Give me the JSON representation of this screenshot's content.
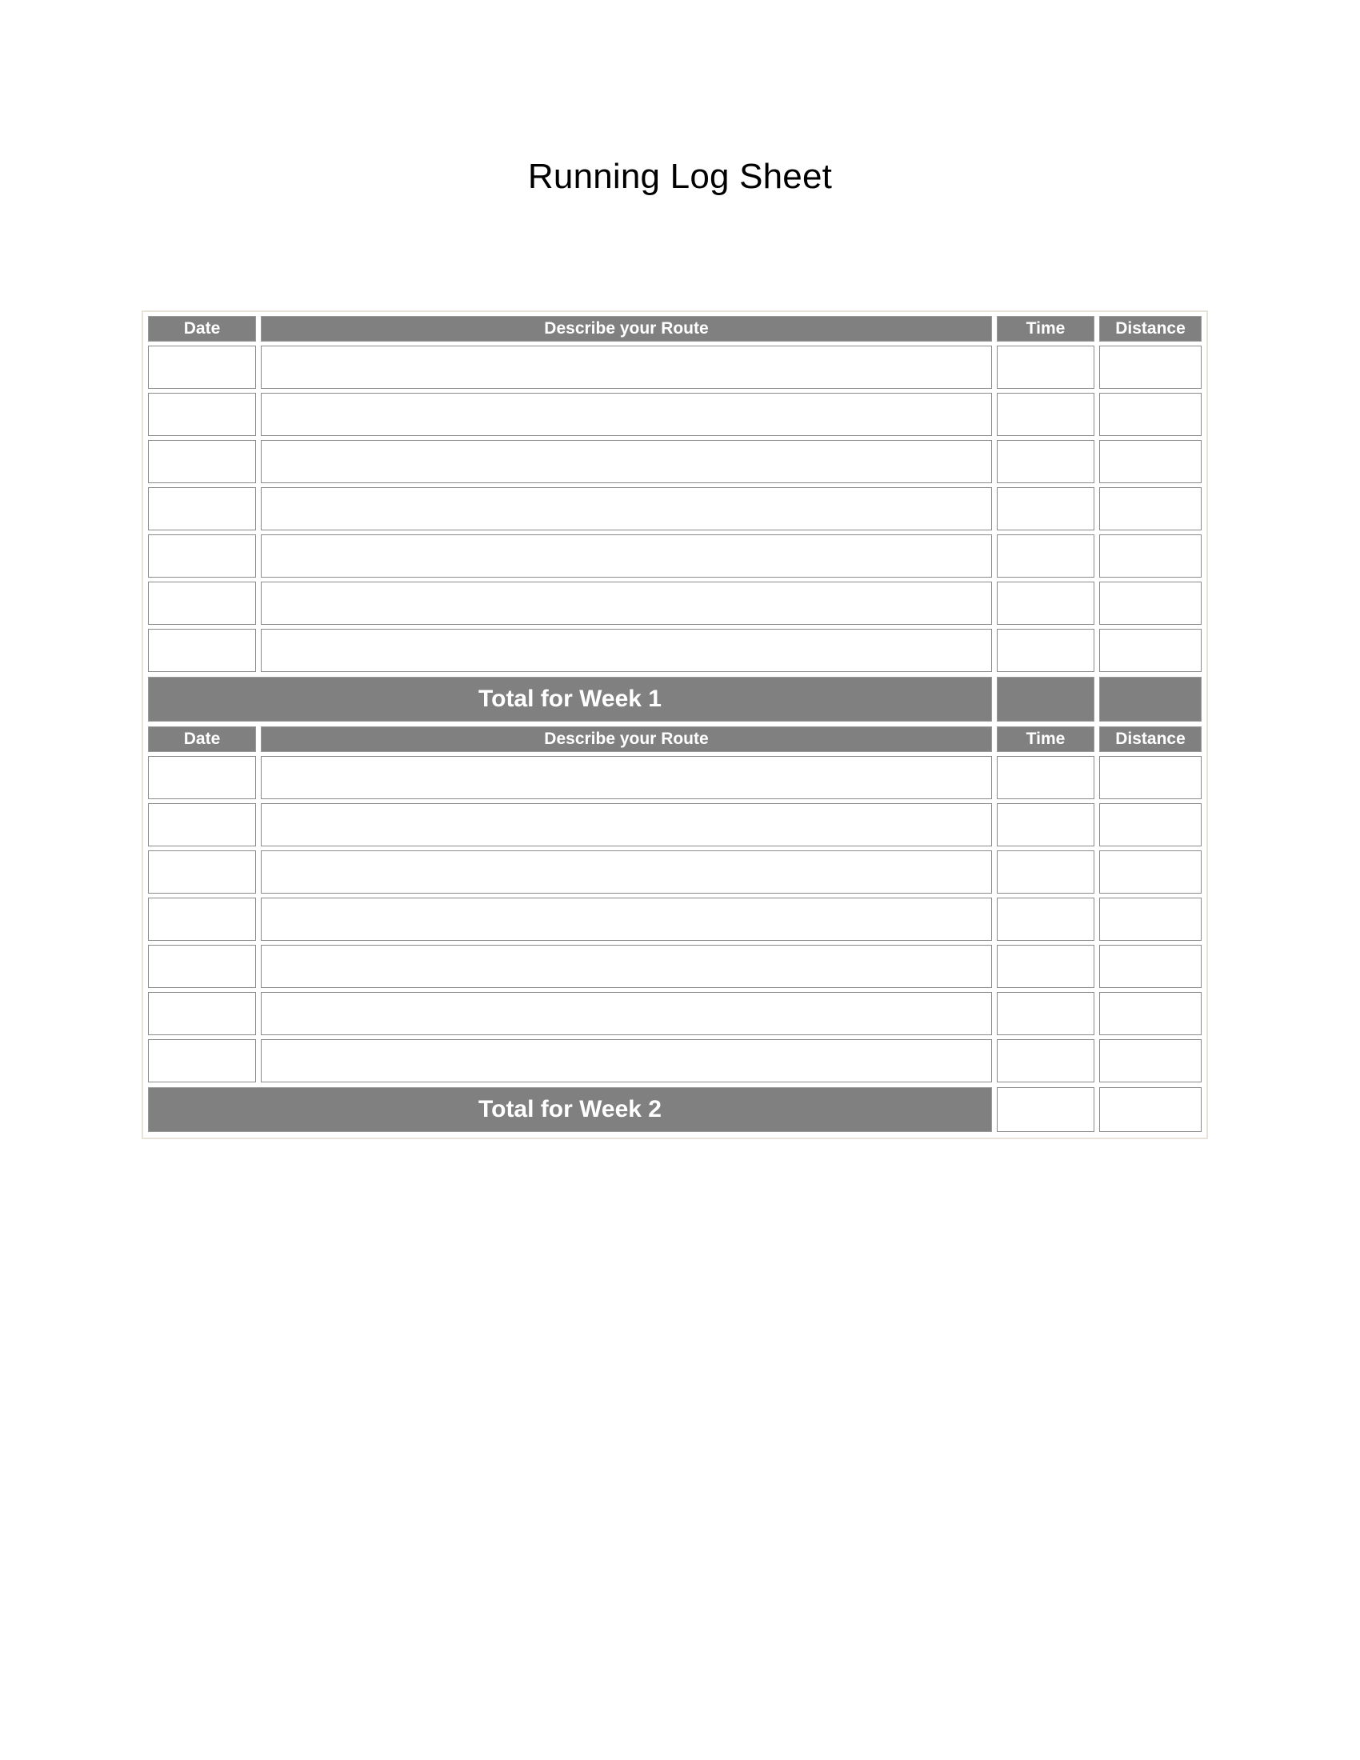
{
  "page": {
    "title": "Running Log Sheet",
    "background_color": "#ffffff"
  },
  "colors": {
    "header_fill": "#808080",
    "header_text": "#ffffff",
    "cell_border": "#8b8b8b",
    "frame_border": "#e7e3da",
    "cell_background": "#ffffff"
  },
  "table": {
    "columns": [
      {
        "key": "date",
        "label": "Date"
      },
      {
        "key": "route",
        "label": "Describe your Route"
      },
      {
        "key": "time",
        "label": "Time"
      },
      {
        "key": "distance",
        "label": "Distance"
      }
    ],
    "sections": [
      {
        "id": "week-1",
        "header": {
          "date": "Date",
          "route": "Describe your Route",
          "time": "Time",
          "distance": "Distance"
        },
        "rows": [
          {
            "date": "",
            "route": "",
            "time": "",
            "distance": ""
          },
          {
            "date": "",
            "route": "",
            "time": "",
            "distance": ""
          },
          {
            "date": "",
            "route": "",
            "time": "",
            "distance": ""
          },
          {
            "date": "",
            "route": "",
            "time": "",
            "distance": ""
          },
          {
            "date": "",
            "route": "",
            "time": "",
            "distance": ""
          },
          {
            "date": "",
            "route": "",
            "time": "",
            "distance": ""
          },
          {
            "date": "",
            "route": "",
            "time": "",
            "distance": ""
          }
        ],
        "total": {
          "label": "Total for Week 1",
          "time": "",
          "distance": "",
          "time_cell_style": "filled",
          "distance_cell_style": "filled"
        }
      },
      {
        "id": "week-2",
        "header": {
          "date": "Date",
          "route": "Describe your Route",
          "time": "Time",
          "distance": "Distance"
        },
        "rows": [
          {
            "date": "",
            "route": "",
            "time": "",
            "distance": ""
          },
          {
            "date": "",
            "route": "",
            "time": "",
            "distance": ""
          },
          {
            "date": "",
            "route": "",
            "time": "",
            "distance": ""
          },
          {
            "date": "",
            "route": "",
            "time": "",
            "distance": ""
          },
          {
            "date": "",
            "route": "",
            "time": "",
            "distance": ""
          },
          {
            "date": "",
            "route": "",
            "time": "",
            "distance": ""
          },
          {
            "date": "",
            "route": "",
            "time": "",
            "distance": ""
          }
        ],
        "total": {
          "label": "Total for Week 2",
          "time": "",
          "distance": "",
          "time_cell_style": "empty",
          "distance_cell_style": "empty"
        }
      }
    ]
  }
}
